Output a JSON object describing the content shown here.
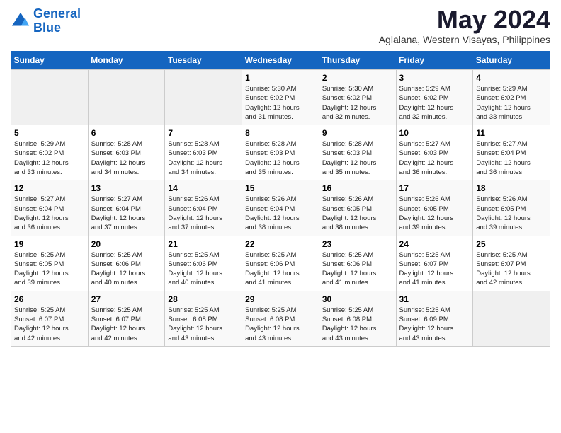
{
  "header": {
    "logo_line1": "General",
    "logo_line2": "Blue",
    "month_year": "May 2024",
    "location": "Aglalana, Western Visayas, Philippines"
  },
  "days_of_week": [
    "Sunday",
    "Monday",
    "Tuesday",
    "Wednesday",
    "Thursday",
    "Friday",
    "Saturday"
  ],
  "weeks": [
    [
      {
        "day": "",
        "info": ""
      },
      {
        "day": "",
        "info": ""
      },
      {
        "day": "",
        "info": ""
      },
      {
        "day": "1",
        "info": "Sunrise: 5:30 AM\nSunset: 6:02 PM\nDaylight: 12 hours\nand 31 minutes."
      },
      {
        "day": "2",
        "info": "Sunrise: 5:30 AM\nSunset: 6:02 PM\nDaylight: 12 hours\nand 32 minutes."
      },
      {
        "day": "3",
        "info": "Sunrise: 5:29 AM\nSunset: 6:02 PM\nDaylight: 12 hours\nand 32 minutes."
      },
      {
        "day": "4",
        "info": "Sunrise: 5:29 AM\nSunset: 6:02 PM\nDaylight: 12 hours\nand 33 minutes."
      }
    ],
    [
      {
        "day": "5",
        "info": "Sunrise: 5:29 AM\nSunset: 6:02 PM\nDaylight: 12 hours\nand 33 minutes."
      },
      {
        "day": "6",
        "info": "Sunrise: 5:28 AM\nSunset: 6:03 PM\nDaylight: 12 hours\nand 34 minutes."
      },
      {
        "day": "7",
        "info": "Sunrise: 5:28 AM\nSunset: 6:03 PM\nDaylight: 12 hours\nand 34 minutes."
      },
      {
        "day": "8",
        "info": "Sunrise: 5:28 AM\nSunset: 6:03 PM\nDaylight: 12 hours\nand 35 minutes."
      },
      {
        "day": "9",
        "info": "Sunrise: 5:28 AM\nSunset: 6:03 PM\nDaylight: 12 hours\nand 35 minutes."
      },
      {
        "day": "10",
        "info": "Sunrise: 5:27 AM\nSunset: 6:03 PM\nDaylight: 12 hours\nand 36 minutes."
      },
      {
        "day": "11",
        "info": "Sunrise: 5:27 AM\nSunset: 6:04 PM\nDaylight: 12 hours\nand 36 minutes."
      }
    ],
    [
      {
        "day": "12",
        "info": "Sunrise: 5:27 AM\nSunset: 6:04 PM\nDaylight: 12 hours\nand 36 minutes."
      },
      {
        "day": "13",
        "info": "Sunrise: 5:27 AM\nSunset: 6:04 PM\nDaylight: 12 hours\nand 37 minutes."
      },
      {
        "day": "14",
        "info": "Sunrise: 5:26 AM\nSunset: 6:04 PM\nDaylight: 12 hours\nand 37 minutes."
      },
      {
        "day": "15",
        "info": "Sunrise: 5:26 AM\nSunset: 6:04 PM\nDaylight: 12 hours\nand 38 minutes."
      },
      {
        "day": "16",
        "info": "Sunrise: 5:26 AM\nSunset: 6:05 PM\nDaylight: 12 hours\nand 38 minutes."
      },
      {
        "day": "17",
        "info": "Sunrise: 5:26 AM\nSunset: 6:05 PM\nDaylight: 12 hours\nand 39 minutes."
      },
      {
        "day": "18",
        "info": "Sunrise: 5:26 AM\nSunset: 6:05 PM\nDaylight: 12 hours\nand 39 minutes."
      }
    ],
    [
      {
        "day": "19",
        "info": "Sunrise: 5:25 AM\nSunset: 6:05 PM\nDaylight: 12 hours\nand 39 minutes."
      },
      {
        "day": "20",
        "info": "Sunrise: 5:25 AM\nSunset: 6:06 PM\nDaylight: 12 hours\nand 40 minutes."
      },
      {
        "day": "21",
        "info": "Sunrise: 5:25 AM\nSunset: 6:06 PM\nDaylight: 12 hours\nand 40 minutes."
      },
      {
        "day": "22",
        "info": "Sunrise: 5:25 AM\nSunset: 6:06 PM\nDaylight: 12 hours\nand 41 minutes."
      },
      {
        "day": "23",
        "info": "Sunrise: 5:25 AM\nSunset: 6:06 PM\nDaylight: 12 hours\nand 41 minutes."
      },
      {
        "day": "24",
        "info": "Sunrise: 5:25 AM\nSunset: 6:07 PM\nDaylight: 12 hours\nand 41 minutes."
      },
      {
        "day": "25",
        "info": "Sunrise: 5:25 AM\nSunset: 6:07 PM\nDaylight: 12 hours\nand 42 minutes."
      }
    ],
    [
      {
        "day": "26",
        "info": "Sunrise: 5:25 AM\nSunset: 6:07 PM\nDaylight: 12 hours\nand 42 minutes."
      },
      {
        "day": "27",
        "info": "Sunrise: 5:25 AM\nSunset: 6:07 PM\nDaylight: 12 hours\nand 42 minutes."
      },
      {
        "day": "28",
        "info": "Sunrise: 5:25 AM\nSunset: 6:08 PM\nDaylight: 12 hours\nand 43 minutes."
      },
      {
        "day": "29",
        "info": "Sunrise: 5:25 AM\nSunset: 6:08 PM\nDaylight: 12 hours\nand 43 minutes."
      },
      {
        "day": "30",
        "info": "Sunrise: 5:25 AM\nSunset: 6:08 PM\nDaylight: 12 hours\nand 43 minutes."
      },
      {
        "day": "31",
        "info": "Sunrise: 5:25 AM\nSunset: 6:09 PM\nDaylight: 12 hours\nand 43 minutes."
      },
      {
        "day": "",
        "info": ""
      }
    ]
  ]
}
